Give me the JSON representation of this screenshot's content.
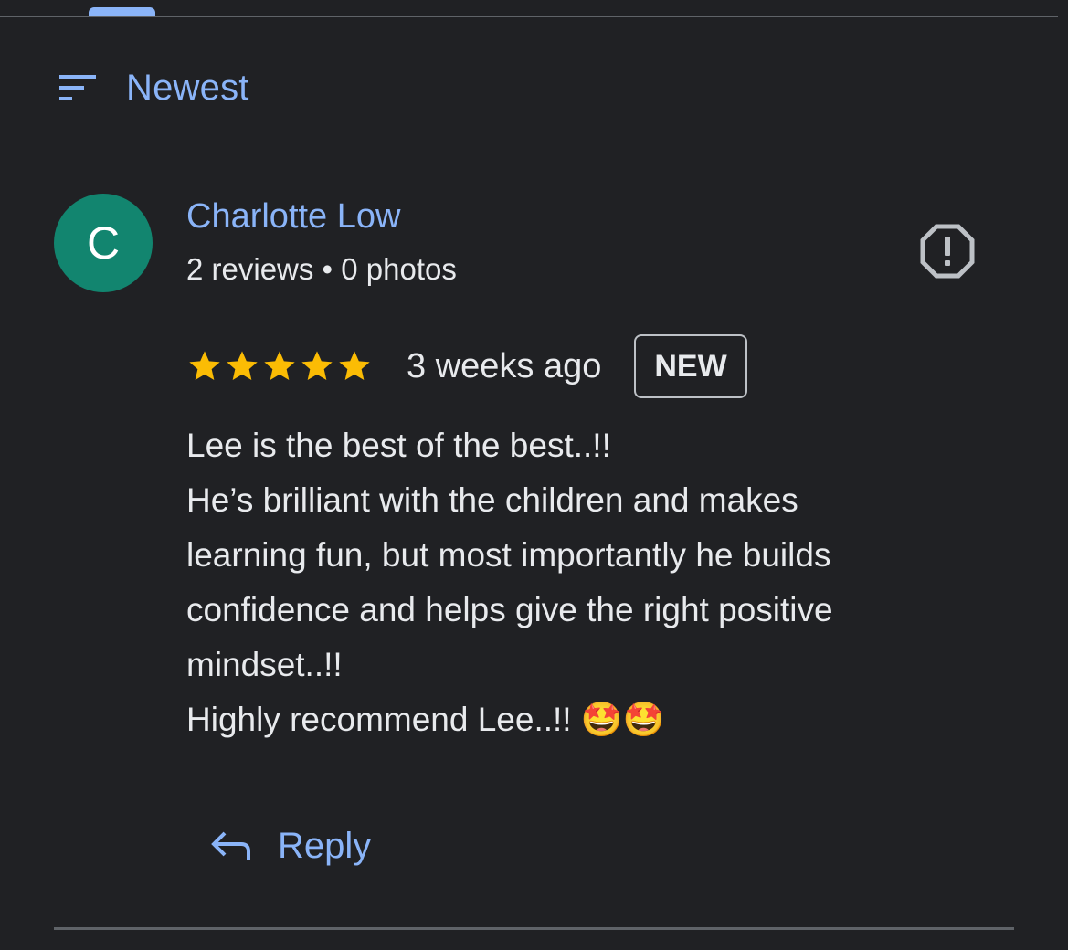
{
  "sort": {
    "label": "Newest",
    "icon": "sort-icon"
  },
  "review": {
    "author": {
      "initial": "C",
      "name": "Charlotte Low",
      "meta": "2 reviews • 0 photos",
      "avatar_color": "#12856f"
    },
    "rating": 5,
    "max_rating": 5,
    "time_ago": "3 weeks ago",
    "badge": "NEW",
    "text_lines": [
      "Lee is the best of the best..!!",
      "He’s brilliant with the children and makes",
      "learning fun, but most importantly he builds",
      "confidence and helps give the right positive",
      "mindset..!!",
      "Highly recommend Lee..!! 🤩🤩"
    ],
    "report_icon": "report-icon"
  },
  "reply": {
    "label": "Reply",
    "icon": "reply-icon"
  },
  "colors": {
    "background": "#202124",
    "accent": "#8ab4f8",
    "star": "#fbbc04",
    "text": "#e8eaed",
    "divider": "#5f6368"
  }
}
